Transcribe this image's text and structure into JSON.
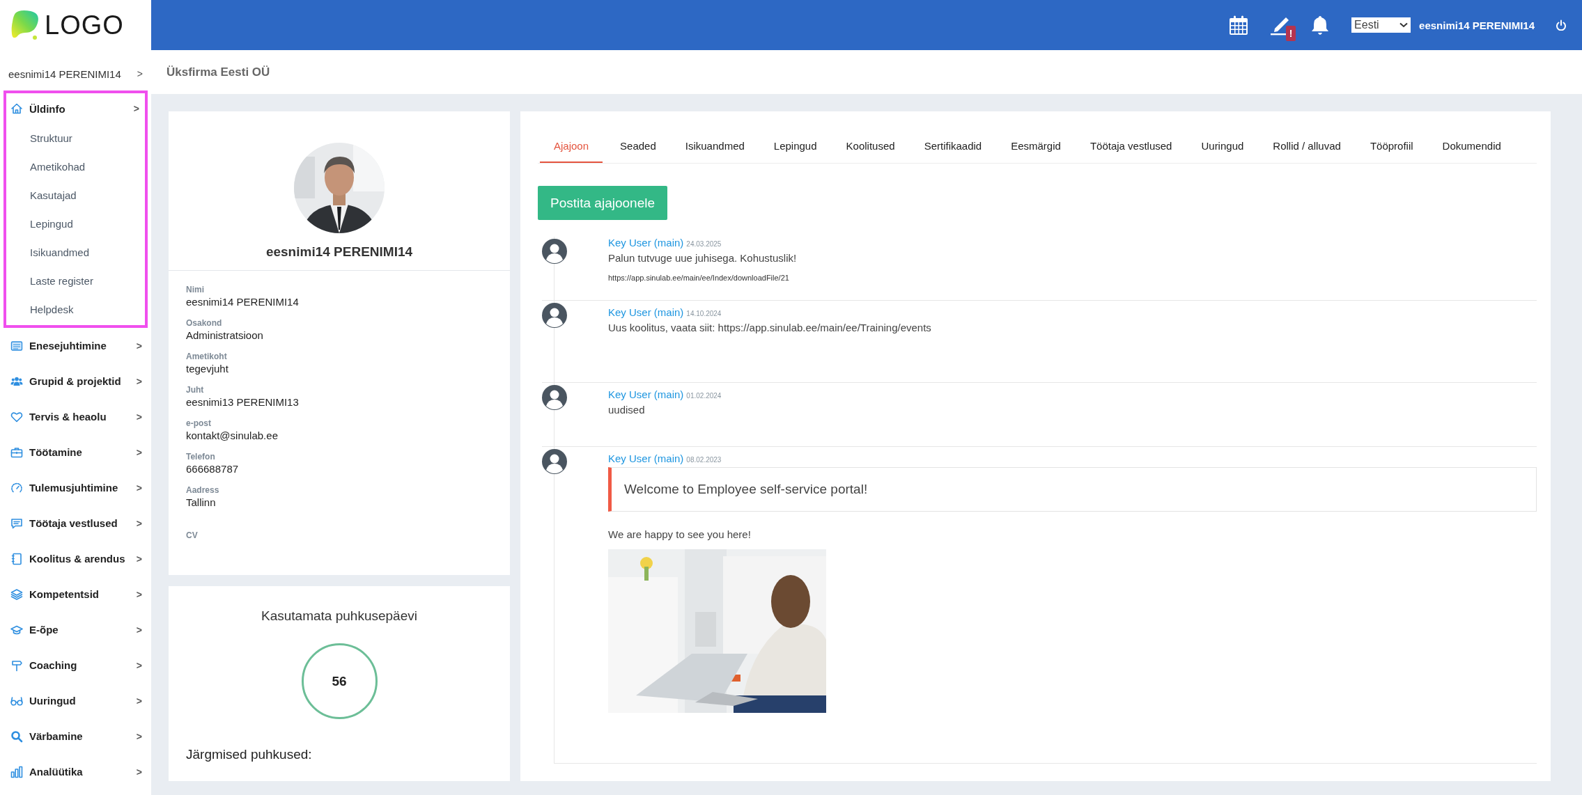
{
  "logo": {
    "text": "LOGO"
  },
  "header": {
    "notification_badge": "!",
    "language": {
      "value": "Eesti"
    },
    "user_name": "eesnimi14 PERENIMI14"
  },
  "sidebar": {
    "user": "eesnimi14 PERENIMI14",
    "chevron": ">",
    "items": [
      {
        "label": "Üldinfo",
        "highlighted": true,
        "children": [
          {
            "label": "Struktuur"
          },
          {
            "label": "Ametikohad"
          },
          {
            "label": "Kasutajad"
          },
          {
            "label": "Lepingud"
          },
          {
            "label": "Isikuandmed"
          },
          {
            "label": "Laste register"
          },
          {
            "label": "Helpdesk"
          }
        ]
      },
      {
        "label": "Enesejuhtimine",
        "highlighted": false
      },
      {
        "label": "Grupid & projektid",
        "highlighted": false
      },
      {
        "label": "Tervis & heaolu",
        "highlighted": false
      },
      {
        "label": "Töötamine",
        "highlighted": false
      },
      {
        "label": "Tulemusjuhtimine",
        "highlighted": false
      },
      {
        "label": "Töötaja vestlused",
        "highlighted": false
      },
      {
        "label": "Koolitus & arendus",
        "highlighted": false
      },
      {
        "label": "Kompetentsid",
        "highlighted": false
      },
      {
        "label": "E-õpe",
        "highlighted": false
      },
      {
        "label": "Coaching",
        "highlighted": false
      },
      {
        "label": "Uuringud",
        "highlighted": false
      },
      {
        "label": "Värbamine",
        "highlighted": false
      },
      {
        "label": "Analüütika",
        "highlighted": false
      }
    ]
  },
  "page_title": "Üksfirma Eesti OÜ",
  "profile": {
    "name": "eesnimi14 PERENIMI14",
    "fields": [
      {
        "label": "Nimi",
        "value": "eesnimi14 PERENIMI14"
      },
      {
        "label": "Osakond",
        "value": "Administratsioon"
      },
      {
        "label": "Ametikoht",
        "value": "tegevjuht"
      },
      {
        "label": "Juht",
        "value": "eesnimi13 PERENIMI13"
      },
      {
        "label": "e-post",
        "value": "kontakt@sinulab.ee"
      },
      {
        "label": "Telefon",
        "value": "666688787"
      },
      {
        "label": "Aadress",
        "value": "Tallinn"
      },
      {
        "label": "CV"
      }
    ]
  },
  "vacation": {
    "title": "Kasutamata puhkusepäevi",
    "days": "56",
    "next_label": "Järgmised puhkused:"
  },
  "tabs": [
    {
      "label": "Ajajoon",
      "selected": true
    },
    {
      "label": "Seaded",
      "selected": false
    },
    {
      "label": "Isikuandmed",
      "selected": false
    },
    {
      "label": "Lepingud",
      "selected": false
    },
    {
      "label": "Koolitused",
      "selected": false
    },
    {
      "label": "Sertifikaadid",
      "selected": false
    },
    {
      "label": "Eesmärgid",
      "selected": false
    },
    {
      "label": "Töötaja vestlused",
      "selected": false
    },
    {
      "label": "Uuringud",
      "selected": false
    },
    {
      "label": "Rollid / alluvad",
      "selected": false
    },
    {
      "label": "Tööprofiil",
      "selected": false
    },
    {
      "label": "Dokumendid",
      "selected": false
    }
  ],
  "post_button": "Postita ajajoonele",
  "timeline": [
    {
      "author": "Key User (main)",
      "date": "24.03.2025",
      "blocks": [
        {
          "kind": "text",
          "text": "Palun tutvuge uue juhisega. Kohustuslik!"
        },
        {
          "kind": "small",
          "text": "https://app.sinulab.ee/main/ee/Index/downloadFile/21"
        }
      ]
    },
    {
      "author": "Key User (main)",
      "date": "14.10.2024",
      "blocks": [
        {
          "kind": "text",
          "text": "Uus koolitus, vaata siit: https://app.sinulab.ee/main/ee/Training/events"
        }
      ]
    },
    {
      "author": "Key User (main)",
      "date": "01.02.2024",
      "blocks": [
        {
          "kind": "text",
          "text": "uudised"
        }
      ]
    },
    {
      "author": "Key User (main)",
      "date": "08.02.2023",
      "blocks": [
        {
          "kind": "callout",
          "text": "Welcome to Employee self-service portal!"
        },
        {
          "kind": "text",
          "text": "We are happy to see you here!"
        },
        {
          "kind": "picture"
        }
      ]
    }
  ]
}
